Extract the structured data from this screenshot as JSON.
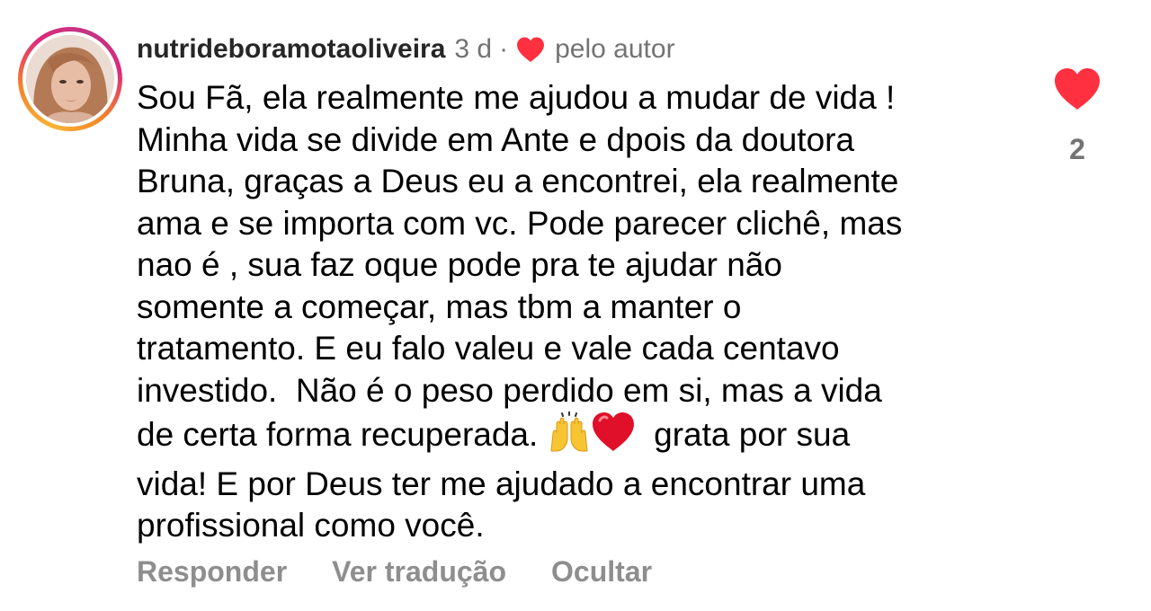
{
  "comment": {
    "username": "nutrideboramotaoliveira",
    "time_ago": "3 d",
    "separator": "·",
    "liked_by_author_label": "pelo autor",
    "text_lines": [
      "Sou Fã, ela realmente me ajudou a mudar de vida !",
      "Minha vida se divide em Ante e dpois da doutora",
      "Bruna, graças a Deus eu a encontrei, ela realmente",
      "ama e se importa com vc. Pode parecer clichê, mas",
      "nao é , sua faz oque pode pra te ajudar não",
      "somente a começar, mas tbm a manter o",
      "tratamento. E eu falo valeu e vale cada centavo",
      "investido.  Não é o peso perdido em si, mas a vida",
      "de certa forma recuperada.",
      "grata por sua",
      "vida! E por Deus ter me ajudado a encontrar uma",
      "profissional como você."
    ],
    "emojis": {
      "raising_hands": "🙌",
      "heart": "❤️"
    },
    "like_count": "2",
    "actions": {
      "reply": "Responder",
      "translate": "Ver tradução",
      "hide": "Ocultar"
    }
  },
  "colors": {
    "like_red": "#ff3040",
    "secondary_text": "#737373",
    "action_text": "#8e8e8e"
  },
  "icons": {
    "author_like": "heart-icon",
    "like_button": "heart-filled-icon"
  }
}
